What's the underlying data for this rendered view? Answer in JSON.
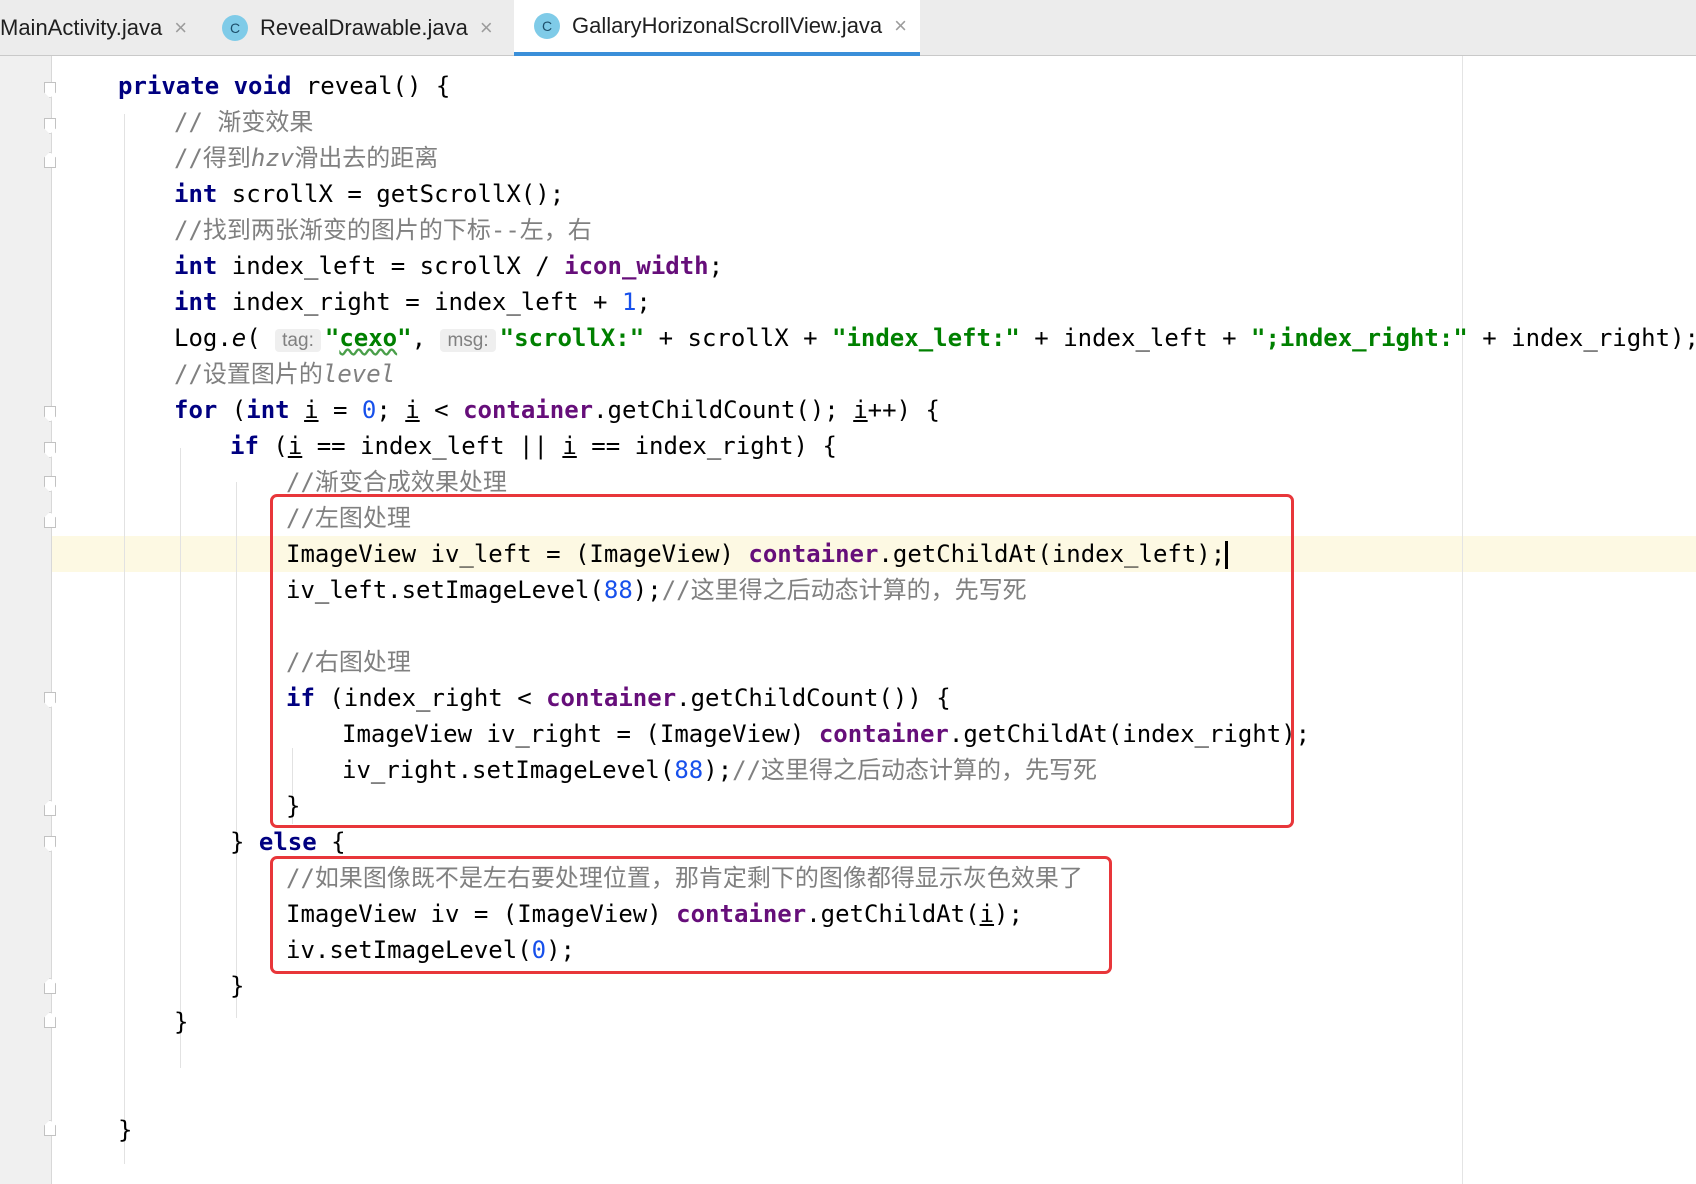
{
  "tabs": [
    {
      "label": "MainActivity.java",
      "icon": "",
      "active": false
    },
    {
      "label": "RevealDrawable.java",
      "icon": "C",
      "active": false
    },
    {
      "label": "GallaryHorizonalScrollView.java",
      "icon": "C",
      "active": true
    }
  ],
  "close_glyph": "×",
  "code": {
    "l1_private": "private",
    "l1_void": "void",
    "l1_rest": " reveal() {",
    "l2": "// 渐变效果",
    "l3a": "//得到",
    "l3b": "hzv",
    "l3c": "滑出去的距离",
    "l4_int": "int",
    "l4_rest": " scrollX = getScrollX();",
    "l5": "//找到两张渐变的图片的下标--左，右",
    "l6_int": "int",
    "l6_mid": " index_left = scrollX / ",
    "l6_field": "icon_width",
    "l6_end": ";",
    "l7_int": "int",
    "l7_mid": " index_right = index_left + ",
    "l7_num": "1",
    "l7_end": ";",
    "l8_log": "Log.",
    "l8_e": "e",
    "l8_paren": "( ",
    "l8_tag_hint": "tag:",
    "l8_q1": "\"",
    "l8_tag": "cexo",
    "l8_q2": "\"",
    "l8_comma": ", ",
    "l8_msg_hint": "msg:",
    "l8_s1": "\"scrollX:\"",
    "l8_p1": " + scrollX + ",
    "l8_s2": "\"index_left:\"",
    "l8_p2": " + index_left + ",
    "l8_s3": "\";index_right:\"",
    "l8_p3": " + index_right);",
    "l9a": "//设置图片的",
    "l9b": "level",
    "l10_for": "for",
    "l10_a": " (",
    "l10_int": "int",
    "l10_b": " ",
    "l10_i1": "i",
    "l10_c": " = ",
    "l10_zero": "0",
    "l10_d": "; ",
    "l10_i2": "i",
    "l10_e": " < ",
    "l10_container": "container",
    "l10_f": ".getChildCount(); ",
    "l10_i3": "i",
    "l10_g": "++) {",
    "l11_if": "if",
    "l11_a": " (",
    "l11_i1": "i",
    "l11_b": " == index_left || ",
    "l11_i2": "i",
    "l11_c": " == index_right) {",
    "l12": "//渐变合成效果处理",
    "l13": "//左图处理",
    "l14_a": "ImageView iv_left = (ImageView) ",
    "l14_container": "container",
    "l14_b": ".getChildAt(index_left);",
    "l15_a": "iv_left.setImageLevel(",
    "l15_num": "88",
    "l15_b": ");",
    "l15_cm": "//这里得之后动态计算的，先写死",
    "l17": "//右图处理",
    "l18_if": "if",
    "l18_a": " (index_right < ",
    "l18_container": "container",
    "l18_b": ".getChildCount()) {",
    "l19_a": "ImageView iv_right = (ImageView) ",
    "l19_container": "container",
    "l19_b": ".getChildAt(index_right);",
    "l20_a": "iv_right.setImageLevel(",
    "l20_num": "88",
    "l20_b": ");",
    "l20_cm": "//这里得之后动态计算的，先写死",
    "l21": "}",
    "l22_a": "} ",
    "l22_else": "else",
    "l22_b": " {",
    "l23": "//如果图像既不是左右要处理位置，那肯定剩下的图像都得显示灰色效果了",
    "l24_a": "ImageView iv = (ImageView) ",
    "l24_container": "container",
    "l24_b": ".getChildAt(",
    "l24_i": "i",
    "l24_c": ");",
    "l25_a": "iv.setImageLevel(",
    "l25_num": "0",
    "l25_b": ");",
    "l26": "}",
    "l27": "}",
    "l30": "}"
  },
  "colors": {
    "highlight_box": "#e8363a",
    "keyword": "#000080",
    "string": "#008000",
    "comment": "#808080",
    "field": "#660e7a",
    "number": "#1750eb"
  }
}
